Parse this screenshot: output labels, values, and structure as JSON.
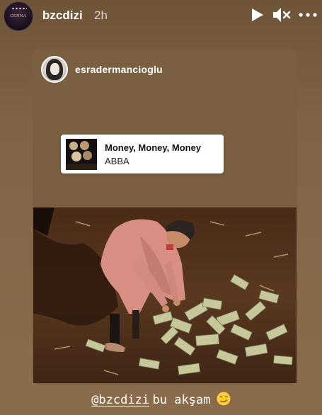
{
  "story": {
    "username": "bzcdizi",
    "time_ago": "2h",
    "avatar_text": "CENNA",
    "icons": {
      "play": "play-icon",
      "mute": "speaker-muted-icon",
      "more": "more-options-icon"
    }
  },
  "shared_post": {
    "username": "esradermancioglu",
    "music": {
      "song": "Money, Money, Money",
      "artist": "ABBA"
    }
  },
  "caption": {
    "mention": "@bzcdizi",
    "text": "bu akşam",
    "emoji": "smirking-face-emoji"
  },
  "colors": {
    "background": "#7e6446",
    "card": "#7a5f41",
    "text": "#ffffff"
  }
}
